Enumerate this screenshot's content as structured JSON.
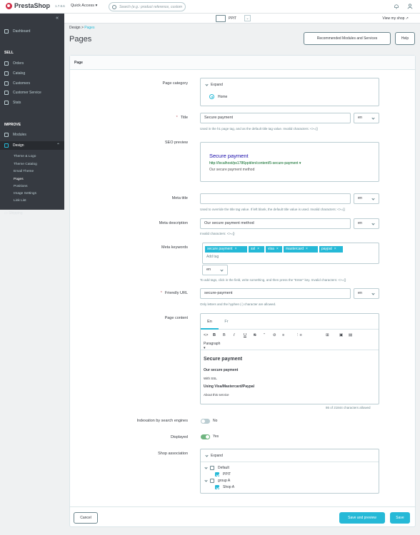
{
  "topbar": {
    "brand": "PrestaShop",
    "version": "1.7.8.6",
    "quick_access": "Quick Access",
    "search_placeholder": "Search (e.g.: product reference, custom",
    "view_shop": "View my shop"
  },
  "shop_selector": {
    "name": "PPIT",
    "arrow": "⌄"
  },
  "sidebar": {
    "collapse_icon": "«",
    "dashboard": "Dashboard",
    "sell_section": "SELL",
    "sell_items": [
      "Orders",
      "Catalog",
      "Customers",
      "Customer Service",
      "Stats"
    ],
    "improve_section": "IMPROVE",
    "modules": "Modules",
    "design": "Design",
    "design_sub": [
      "Theme & Logo",
      "Theme Catalog",
      "Email Theme",
      "Pages",
      "Positions",
      "Image Settings",
      "Link List"
    ],
    "shipping": "Shipping"
  },
  "breadcrumb": {
    "parent": "Design",
    "sep": ">",
    "current": "Pages"
  },
  "page_title": "Pages",
  "header_buttons": {
    "recommended": "Recommended Modules and Services",
    "help": "Help"
  },
  "card_title": "Page",
  "form": {
    "page_category": {
      "label": "Page category",
      "expand": "Expand",
      "home": "Home"
    },
    "title": {
      "label": "Title",
      "required": "*",
      "value": "Secure payment",
      "lang": "en",
      "help": "Used in the h1 page tag, and as the default title tag value. Invalid characters: <>={}"
    },
    "seo_preview": {
      "label": "SEO preview",
      "title": "Secure payment",
      "url": "http://localhost/ps1786ppit/en/content/5-secure-payment",
      "url_arrow": "▾",
      "desc": "Our secure payment method"
    },
    "meta_title": {
      "label": "Meta title",
      "value": "",
      "lang": "en",
      "help": "Used to override the title tag value. If left blank, the default title value is used. Invalid characters: <>={}"
    },
    "meta_description": {
      "label": "Meta description",
      "value": "Our secure payment method",
      "lang": "en",
      "help": "Invalid characters: <>={}"
    },
    "meta_keywords": {
      "label": "Meta keywords",
      "tags": [
        "secure payment",
        "ssl",
        "visa",
        "mastercard",
        "paypal"
      ],
      "tag_close": "×",
      "add_tag": "Add tag",
      "lang": "en",
      "help": "To add tags, click in the field, write something, and then press the \"Enter\" key. Invalid characters: <>={}"
    },
    "friendly_url": {
      "label": "Friendly URL",
      "required": "*",
      "value": "secure-payment",
      "lang": "en",
      "help": "Only letters and the hyphen (-) character are allowed."
    },
    "page_content": {
      "label": "Page content",
      "tabs": [
        "En",
        "Fr"
      ],
      "paragraph_select": "Paragraph",
      "toolbar": [
        "<>",
        "B",
        "I",
        "U",
        "S",
        "”",
        "⊘",
        "≡",
        "⋮≡",
        "⊞",
        "▣",
        "▤"
      ],
      "heading": "Secure payment",
      "line1": "Our secure payment",
      "line2": "With SSL",
      "line3": "Using Visa/Mastercard/Paypal",
      "line4": "About this service",
      "char_count": "86 of 21844 characters allowed"
    },
    "indexation": {
      "label": "Indexation by search engines",
      "value": "No",
      "on": false
    },
    "displayed": {
      "label": "Displayed",
      "value": "Yes",
      "on": true
    },
    "shop_association": {
      "label": "Shop association",
      "expand": "Expand",
      "default": "Default",
      "ppit": "PPIT",
      "group_a": "group A",
      "shop_a": "Shop A"
    }
  },
  "footer": {
    "cancel": "Cancel",
    "save_preview": "Save and preview",
    "save": "Save"
  },
  "colors": {
    "primary": "#25b9d7",
    "sidebar": "#363a41",
    "toggle_on": "#70b580",
    "danger": "#c05c67"
  }
}
